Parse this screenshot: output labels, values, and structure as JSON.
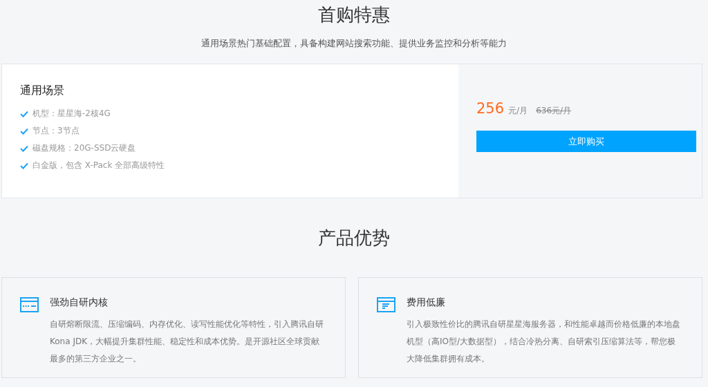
{
  "offer": {
    "title": "首购特惠",
    "subtitle": "通用场景热门基础配置，具备构建网站搜索功能、提供业务监控和分析等能力"
  },
  "plan": {
    "name": "通用场景",
    "features": [
      "机型：星星海-2核4G",
      "节点：3节点",
      "磁盘规格：20G-SSD云硬盘",
      "白金版，包含 X-Pack 全部高级特性"
    ],
    "price": "256",
    "price_unit": "元/月",
    "original_price": "636元/月",
    "buy_button": "立即购买"
  },
  "advantages": {
    "title": "产品优势",
    "items": [
      {
        "kind": "dashes",
        "title": "强劲自研内核",
        "text": "自研熔断限流、压缩编码、内存优化、读写性能优化等特性，引入腾讯自研Kona JDK，大幅提升集群性能、稳定性和成本优势。是开源社区全球贡献最多的第三方企业之一。"
      },
      {
        "kind": "lines",
        "title": "费用低廉",
        "text": "引入极致性价比的腾讯自研星星海服务器，和性能卓越而价格低廉的本地盘机型（高IO型/大数据型），结合冷热分离、自研索引压缩算法等，帮您极大降低集群拥有成本。"
      }
    ]
  }
}
